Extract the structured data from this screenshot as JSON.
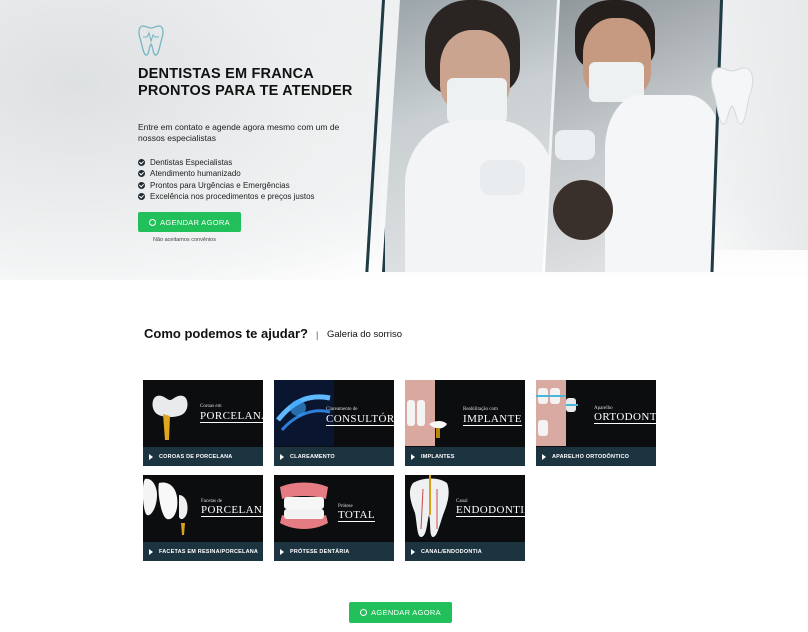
{
  "hero": {
    "title_main": "DENTISTAS EM FRANCA PRONTOS PARA ",
    "title_bold": "TE ATENDER",
    "subtitle": "Entre em contato e agende agora mesmo com um de nossos especialistas",
    "bullets": [
      "Dentistas Especialistas",
      "Atendimento humanizado",
      "Prontos para Urgências e Emergências",
      "Excelência nos procedimentos e preços justos"
    ],
    "cta_label": "AGENDAR AGORA",
    "note": "Não aceitamos convênios"
  },
  "section": {
    "title": "Como podemos te ajudar?",
    "separator": "|",
    "gallery_link": "Galeria do sorriso"
  },
  "services": [
    {
      "small": "Coroas em",
      "big": "PORCELANA",
      "label": "COROAS DE PORCELANA"
    },
    {
      "small": "Clareamento de",
      "big": "CONSULTÓRIO",
      "label": "CLAREAMENTO"
    },
    {
      "small": "Reabilitação com",
      "big": "IMPLANTE",
      "label": "IMPLANTES"
    },
    {
      "small": "Aparelho",
      "big": "ORTODONTICO",
      "label": "APARELHO ORTODÔNTICO"
    },
    {
      "small": "Facetas de",
      "big": "PORCELANA",
      "label": "FACETAS EM RESINA/PORCELANA"
    },
    {
      "small": "Prótese",
      "big": "TOTAL",
      "label": "PRÓTESE DENTÁRIA"
    },
    {
      "small": "Canal",
      "big": "ENDODONTIA",
      "label": "CANAL/ENDODONTIA"
    }
  ],
  "bottom_cta_label": "AGENDAR AGORA",
  "colors": {
    "cta_green": "#21c05a",
    "card_bar": "#1c3340",
    "accent_dark": "#1f3b44"
  }
}
